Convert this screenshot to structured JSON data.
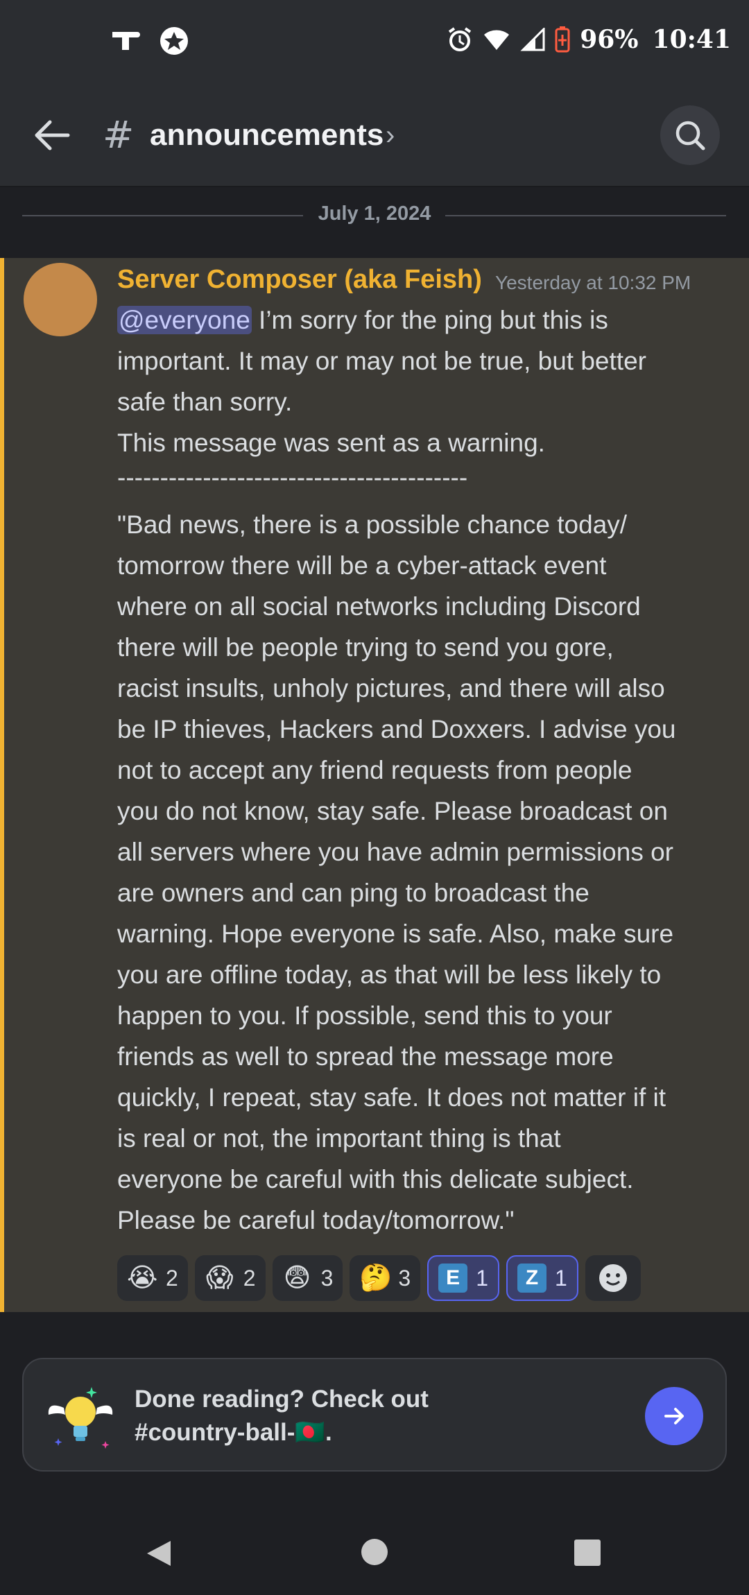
{
  "status_bar": {
    "battery": "96%",
    "time": "10:41",
    "left_icons": [
      "tiktok-icon",
      "star-circle-icon"
    ],
    "right_icons": [
      "alarm-icon",
      "wifi-icon",
      "signal-icon",
      "battery-saver-icon"
    ]
  },
  "header": {
    "channel_name": "announcements",
    "hash": "#",
    "chevron": "›"
  },
  "date_divider": "July 1, 2024",
  "message": {
    "author": "Server Composer (aka Feish)",
    "timestamp": "Yesterday at 10:32 PM",
    "mention": "@everyone",
    "lines": [
      " I’m sorry for the ping but this is",
      "important. It may or may not be true, but better",
      "safe than sorry.",
      "This message was sent as a warning.",
      "-----------------------------------------",
      "\"Bad news, there is a possible chance today/",
      "tomorrow there will be a cyber-attack event",
      "where on all social networks including Discord",
      "there will be people trying to send you gore,",
      "racist insults, unholy pictures, and there will also",
      "be IP thieves, Hackers and Doxxers. I advise you",
      "not to accept any friend requests from people",
      "you do not know, stay safe. Please broadcast on",
      "all servers where you have admin permissions or",
      "are owners and can ping to broadcast the",
      "warning. Hope everyone is safe. Also, make sure",
      "you are offline today, as that will be less likely to",
      "happen to you. If possible, send this to your",
      "friends as well to spread the message more",
      "quickly, I repeat, stay safe. It does not matter if it",
      "is real or not, the important thing is that",
      "everyone be careful with this delicate subject.",
      "Please be careful today/tomorrow.\""
    ],
    "accent_color": "#f0b232"
  },
  "reactions": [
    {
      "emoji": "😭",
      "count": "2",
      "me": false
    },
    {
      "emoji": "😱",
      "count": "2",
      "me": false
    },
    {
      "emoji": "😨",
      "count": "3",
      "me": false
    },
    {
      "emoji": "🤔",
      "count": "3",
      "me": false
    },
    {
      "emoji": "E",
      "count": "1",
      "me": true
    },
    {
      "emoji": "Z",
      "count": "1",
      "me": true
    }
  ],
  "footer": {
    "line1": "Done reading? Check out",
    "line2": "#country-ball-🇧🇩."
  }
}
